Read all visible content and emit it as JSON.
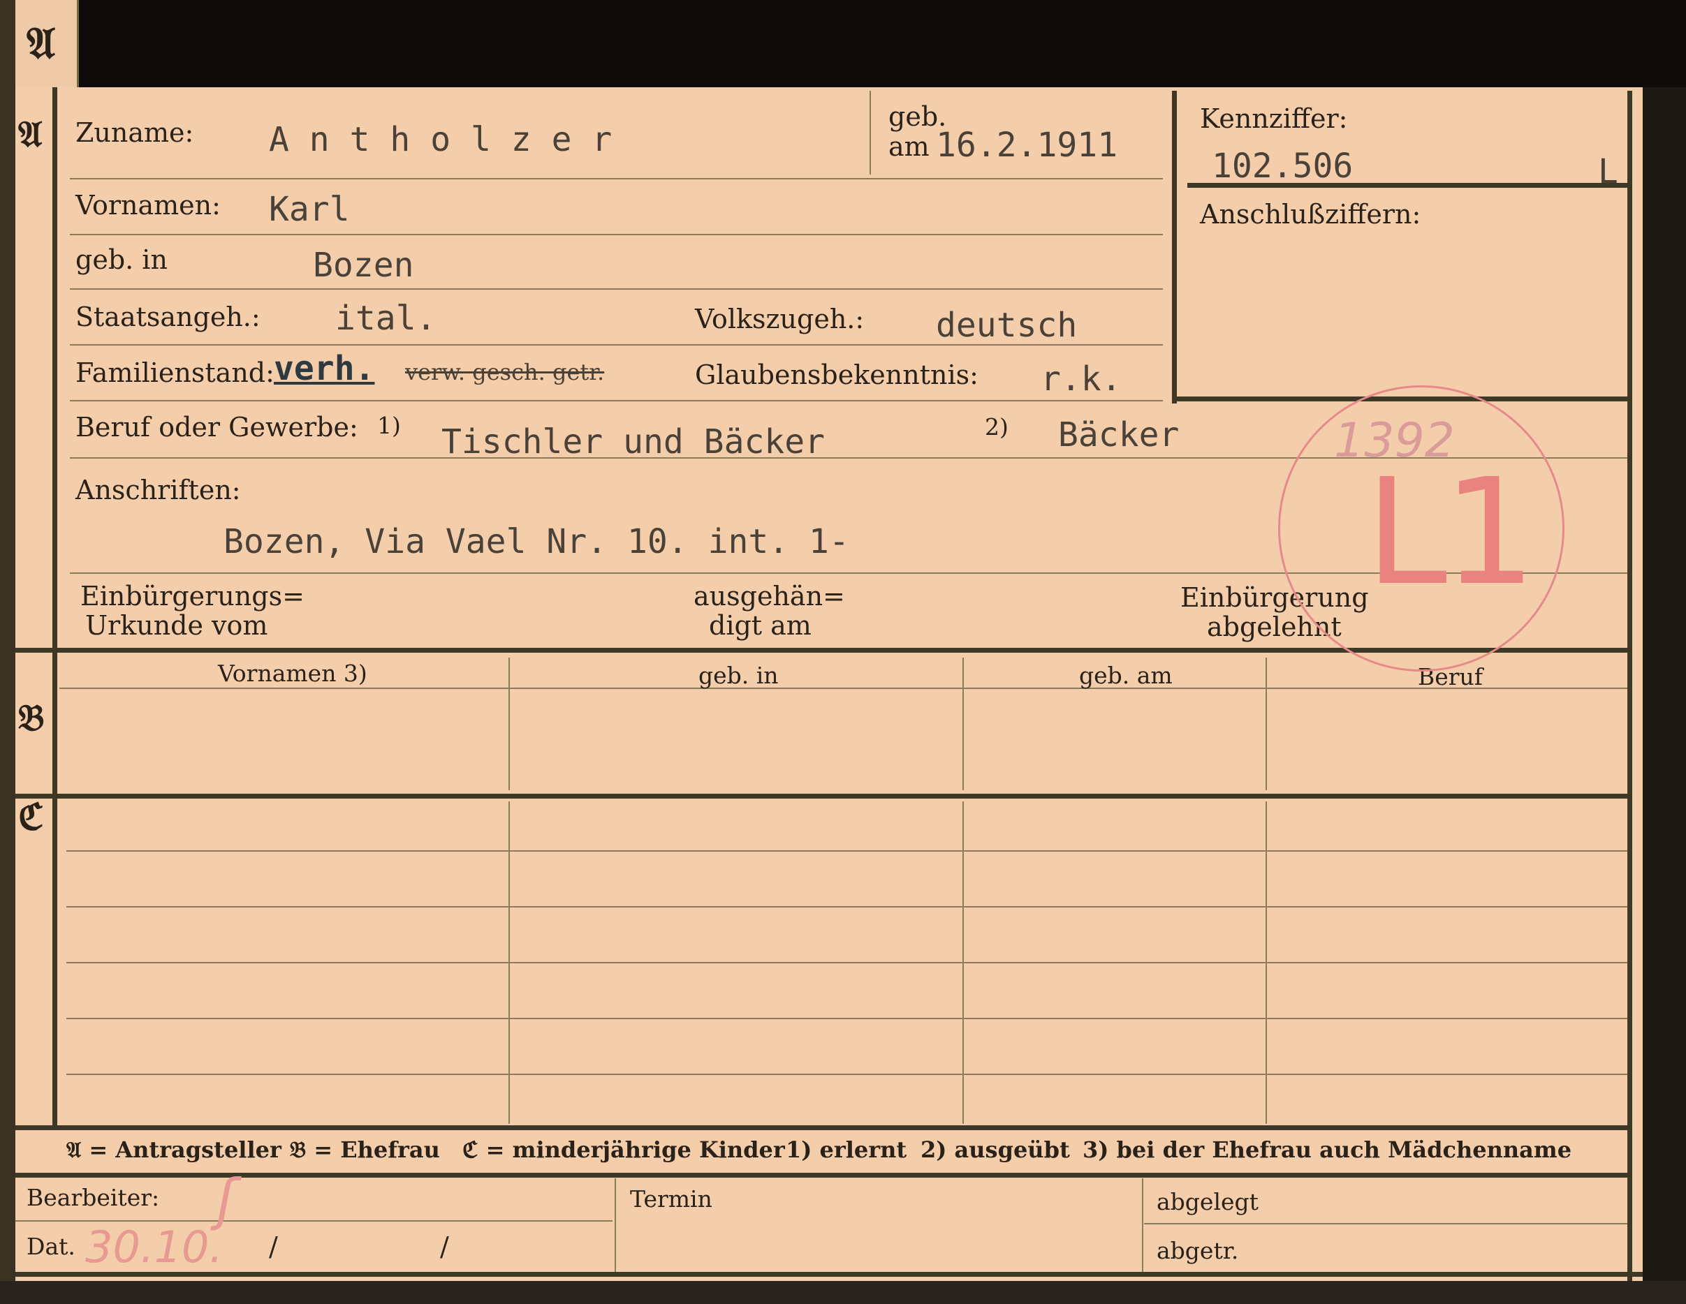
{
  "tab_letter": "𝔄",
  "sections": {
    "a": "𝔄",
    "b": "𝔅",
    "c": "ℭ"
  },
  "labels": {
    "zuname": "Zuname:",
    "geb": "geb.",
    "am": "am",
    "kennziffer": "Kennziffer:",
    "anschlussziffern": "Anschlußziffern:",
    "vornamen": "Vornamen:",
    "geb_in": "geb. in",
    "staatsangeh": "Staatsangeh.:",
    "volkszugeh": "Volkszugeh.:",
    "familienstand": "Familienstand:",
    "familienstand_options": "verw. gesch. getr.",
    "glaubensbekenntnis": "Glaubensbekenntnis:",
    "beruf": "Beruf oder Gewerbe:",
    "beruf_note1": "1)",
    "beruf_note2": "2)",
    "anschriften": "Anschriften:",
    "einbuergerung_urkunde_1": "Einbürgerungs=",
    "einbuergerung_urkunde_2": "Urkunde vom",
    "ausgehaendigt_1": "ausgehän=",
    "ausgehaendigt_2": "digt am",
    "einbuergerung_abgelehnt_1": "Einbürgerung",
    "einbuergerung_abgelehnt_2": "abgelehnt",
    "bearbeiter": "Bearbeiter:",
    "termin": "Termin",
    "abgelegt": "abgelegt",
    "dat": "Dat.",
    "abgetr": "abgetr.",
    "slash1": "/",
    "slash2": "/"
  },
  "values": {
    "zuname": "A n t h o l z e r",
    "geb_am": "16.2.1911",
    "kennziffer": "102.506",
    "kennziffer_suffix": "L",
    "vornamen": "Karl",
    "geb_in": "Bozen",
    "staatsangeh": "ital.",
    "volkszugeh": "deutsch",
    "familienstand": "verh.",
    "glaubensbekenntnis": "r.k.",
    "beruf_erlernt": "Tischler und Bäcker",
    "beruf_ausgeuebt": "Bäcker",
    "anschrift": "Bozen, Via Vael Nr. 10. int. 1-"
  },
  "table_b": {
    "headers": [
      "Vornamen 3)",
      "geb. in",
      "geb. am",
      "Beruf"
    ]
  },
  "legend": {
    "a": "𝔄 = Antragsteller",
    "b": "𝔅 = Ehefrau",
    "c": "ℭ = minderjährige Kinder",
    "n1": "1) erlernt",
    "n2": "2) ausgeübt",
    "n3": "3) bei der Ehefrau auch Mädchenname"
  },
  "stamp": {
    "code": "L1",
    "number": "1392"
  },
  "handwritten": {
    "bearbeiter_mark": "ʃ",
    "dat": "30.10."
  },
  "colors": {
    "card": "#f4cdab",
    "ink": "#2a2218",
    "stamp": "#e9837f"
  }
}
